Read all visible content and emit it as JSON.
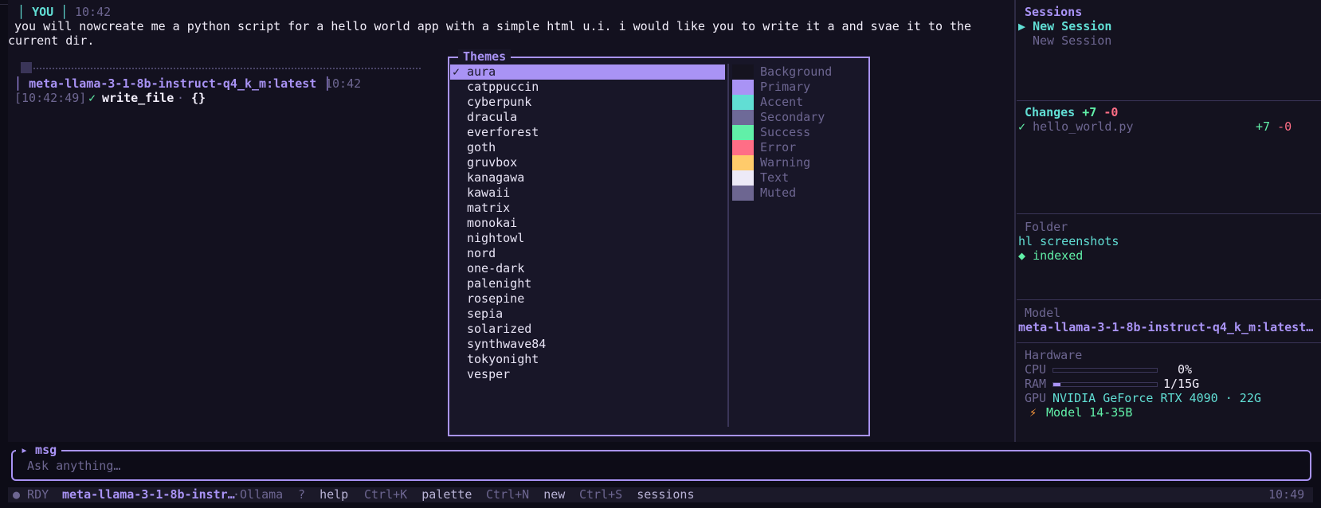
{
  "chat": {
    "user_tag": "YOU",
    "user_time": "10:42",
    "user_message_line1": "you will nowcreate me a python script for a hello world app with a simple html u.i. i would like you to write it a and svae it to the",
    "user_message_line2": "current dir.",
    "assistant_model": "meta-llama-3-1-8b-instruct-q4_k_m:latest",
    "assistant_time": "10:42",
    "tool_timestamp": "[10:42:49]",
    "tool_check": "✓",
    "tool_name": "write_file",
    "tool_sep": "·",
    "tool_args": "{}"
  },
  "themes_modal": {
    "title": "Themes",
    "selected_mark": "✓",
    "items": [
      "aura",
      "catppuccin",
      "cyberpunk",
      "dracula",
      "everforest",
      "goth",
      "gruvbox",
      "kanagawa",
      "kawaii",
      "matrix",
      "monokai",
      "nightowl",
      "nord",
      "one-dark",
      "palenight",
      "rosepine",
      "sepia",
      "solarized",
      "synthwave84",
      "tokyonight",
      "vesper"
    ],
    "preview": [
      {
        "label": "Background",
        "color": "#15131f"
      },
      {
        "label": "Primary",
        "color": "#a993f5"
      },
      {
        "label": "Accent",
        "color": "#61ded4"
      },
      {
        "label": "Secondary",
        "color": "#6e6a98"
      },
      {
        "label": "Success",
        "color": "#61f0a8"
      },
      {
        "label": "Error",
        "color": "#ff6e86"
      },
      {
        "label": "Warning",
        "color": "#ffcb6b"
      },
      {
        "label": "Text",
        "color": "#edeaf7"
      },
      {
        "label": "Muted",
        "color": "#6d6691"
      }
    ]
  },
  "sidebar": {
    "sessions_title": "Sessions",
    "sessions": [
      {
        "marker": "▶",
        "label": "New Session"
      },
      {
        "marker": "",
        "label": "New Session"
      }
    ],
    "changes_title": "Changes",
    "changes_add": "+7",
    "changes_del": "-0",
    "change_files": [
      {
        "check": "✓",
        "name": "hello_world.py",
        "add": "+7",
        "del": "-0"
      }
    ],
    "folder_title": "Folder",
    "folder_name": "hl screenshots",
    "folder_status_icon": "◆",
    "folder_status": "indexed",
    "model_title": "Model",
    "model_name": "meta-llama-3-1-8b-instruct-q4_k_m:latest…",
    "hardware_title": "Hardware",
    "cpu_label": "CPU",
    "cpu_value": "0%",
    "cpu_fraction": 0.0,
    "ram_label": "RAM",
    "ram_value": "1/15G",
    "ram_fraction": 0.067,
    "gpu_label": "GPU",
    "gpu_value": "NVIDIA GeForce RTX 4090 · 22G",
    "model_fit_icon": "⚡",
    "model_fit": "Model 14-35B"
  },
  "input": {
    "label": "▸ msg",
    "placeholder": "Ask anything…"
  },
  "statusbar": {
    "status": "● RDY",
    "model": "meta-llama-3-1-8b-instr…",
    "provider": "·Ollama",
    "shortcuts": [
      {
        "key": "?",
        "label": "help"
      },
      {
        "key": "Ctrl+K",
        "label": "palette"
      },
      {
        "key": "Ctrl+N",
        "label": "new"
      },
      {
        "key": "Ctrl+S",
        "label": "sessions"
      }
    ],
    "clock": "10:49"
  }
}
